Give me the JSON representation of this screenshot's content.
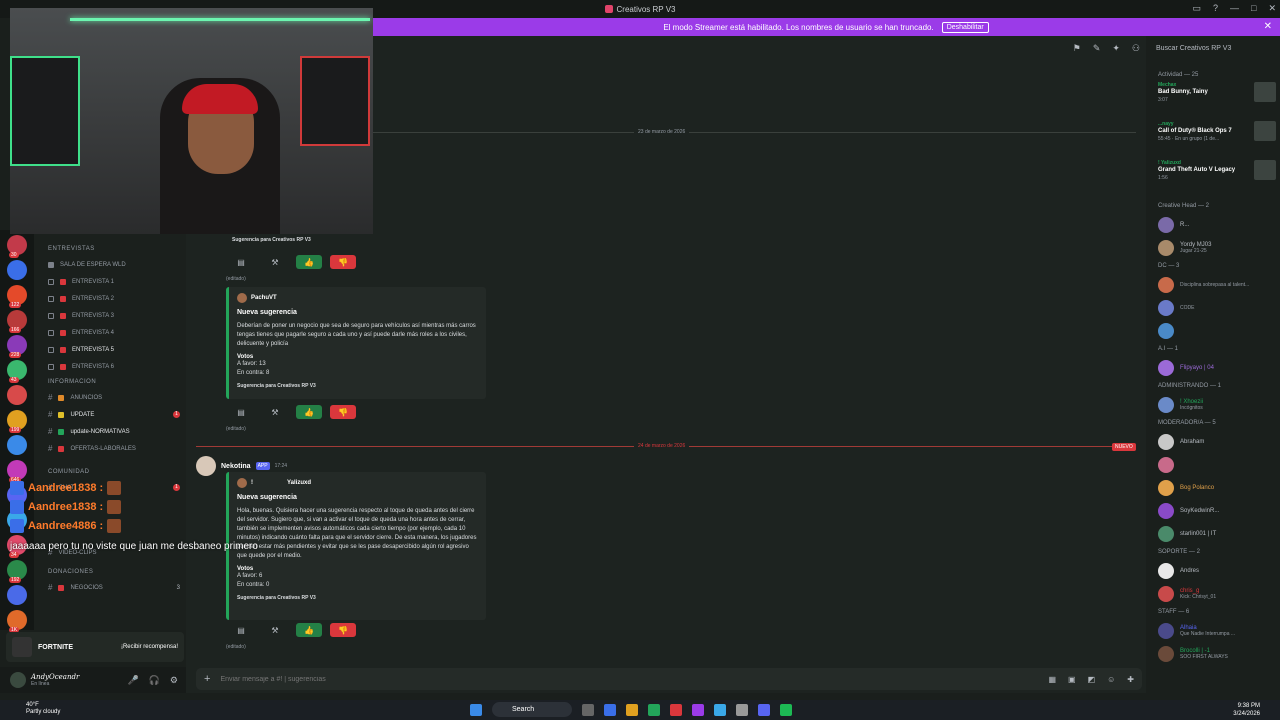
{
  "window": {
    "title": "Creativos RP V3"
  },
  "banner": {
    "text": "El modo Streamer está habilitado. Los nombres de usuario se han truncado.",
    "button": "Deshabilitar"
  },
  "search": {
    "placeholder": "Buscar Creativos RP V3"
  },
  "server_rail": [
    {
      "count": "30",
      "color": "#c23a4a"
    },
    {
      "count": "",
      "color": "#3a6ee8"
    },
    {
      "count": "122",
      "color": "#e44a2a"
    },
    {
      "count": "166",
      "color": "#b83a3a"
    },
    {
      "count": "228",
      "color": "#8a3ab8"
    },
    {
      "count": "43",
      "color": "#3ab86e"
    },
    {
      "count": "",
      "color": "#d84a4a"
    },
    {
      "count": "199",
      "color": "#e0a020"
    },
    {
      "count": "",
      "color": "#3a8ae8"
    },
    {
      "count": "646",
      "color": "#c23ab8"
    },
    {
      "count": "",
      "color": "#5865f2"
    },
    {
      "count": "",
      "color": "#3aa8e8"
    },
    {
      "count": "34",
      "color": "#e04a6a"
    },
    {
      "count": "192",
      "color": "#2a8a4a"
    },
    {
      "count": "",
      "color": "#4a6ae8"
    },
    {
      "count": "1K",
      "color": "#e06a2a"
    },
    {
      "count": "",
      "color": "#2ab86a"
    }
  ],
  "channels": {
    "cat_entrevistas": "ENTREVISTAS",
    "sala_espera": "SALA DE ESPERA WLD",
    "entrevista_1": "ENTREVISTA 1",
    "entrevista_2": "ENTREVISTA 2",
    "entrevista_3": "ENTREVISTA 3",
    "entrevista_4": "ENTREVISTA 4",
    "entrevista_5": "ENTREVISTA 5",
    "entrevista_6": "ENTREVISTA 6",
    "cat_informacion": "INFORMACION",
    "anuncios": "ANUNCIOS",
    "update": "UPDATE",
    "update_badge": "1",
    "update_normativas": "update-NORMATIVAS",
    "ofertas": "OFERTAS-LABORALES",
    "cat_comunidad": "COMUNIDAD",
    "chat": "CHAT",
    "chat_badge": "1",
    "clips": "VIDEO-CLIPS",
    "cat_donaciones": "DONACIONES",
    "negocios": "NEGOCIOS",
    "negocios_count": "3"
  },
  "fortnite": {
    "name": "FORTNITE",
    "cta": "¡Recibir recompensa!"
  },
  "user": {
    "name": "AndyOceandr",
    "status": "En línea"
  },
  "messages": {
    "footer_label": "Sugerencia para Creativos RP V3",
    "edited": "(editado)",
    "date1": "23 de marzo de 2026",
    "date2": "24 de marzo de 2026",
    "new_tag": "NUEVO",
    "embed1": {
      "author": "PachuVT",
      "title": "Nueva sugerencia",
      "desc": "Deberían de poner un negocio que sea de seguro para vehículos así mientras más carros tengas tienes que pagarle seguro a cada uno y así puede darle más roles a los civiles, delicuente y policía",
      "votes_label": "Votos",
      "favor": "A favor: 13",
      "contra": "En contra: 8",
      "footer": "Sugerencia para Creativos RP V3"
    },
    "msg2": {
      "name": "Nekotina",
      "app": "APP",
      "time": "17:24"
    },
    "embed2": {
      "author_prefix": "!",
      "author": "Yalizuxd",
      "title": "Nueva sugerencia",
      "desc": "Hola, buenas. Quisiera hacer una sugerencia respecto al toque de queda antes del cierre del servidor. Sugiero que, si van a activar el toque de queda una hora antes de cerrar, también se implementen avisos automáticos cada cierto tiempo (por ejemplo, cada 10 minutos) indicando cuánto falta para que el servidor cierre. De esta manera, los jugadores pueden estar más pendientes y evitar que se les pase desapercibido algún rol agresivo que quede por el medio.",
      "votes_label": "Votos",
      "favor": "A favor: 6",
      "contra": "En contra: 0",
      "footer": "Sugerencia para Creativos RP V3"
    }
  },
  "composer": {
    "placeholder": "Enviar mensaje a #! | sugerencias"
  },
  "sidebar": {
    "activity_header": "Actividad — 25",
    "activities": [
      {
        "who": "Mechax",
        "game": "Bad Bunny, Tainy",
        "sub": "3:07"
      },
      {
        "who": "...nayy",
        "game": "Call of Duty® Black Ops 7",
        "sub": "55:45 · En un grupo (1 de..."
      },
      {
        "who": "! Yalizuxd",
        "game": "Grand Theft Auto V Legacy",
        "sub": "1:56"
      }
    ],
    "groups": [
      {
        "header": "Creative Head — 2",
        "members": [
          {
            "name": "R...",
            "sub": "",
            "color": "#b5bac1",
            "av": "#7a6aa8"
          },
          {
            "name": "Yordy MJ03",
            "sub": "Jugar 21-25",
            "color": "#b5bac1",
            "av": "#a88a6a"
          }
        ]
      },
      {
        "header": "DC — 3",
        "members": [
          {
            "name": "",
            "sub": "Disciplina sobrepasa al talent...",
            "color": "#da373c",
            "av": "#c86a4a"
          },
          {
            "name": "",
            "sub": "CODE",
            "color": "#da373c",
            "av": "#6a7ac8"
          },
          {
            "name": "",
            "sub": "",
            "color": "#da373c",
            "av": "#4a8ac8"
          }
        ]
      },
      {
        "header": "A.I — 1",
        "members": [
          {
            "name": "Flipyayo | 04",
            "sub": "",
            "color": "#9b6ad8",
            "av": "#9b6ad8"
          }
        ]
      },
      {
        "header": "ADMINISTRANDO — 1",
        "members": [
          {
            "name": "! Xhoezii",
            "sub": "Incógnitos",
            "color": "#23a55a",
            "av": "#6a8ac8"
          }
        ]
      },
      {
        "header": "MODERADOR/A — 5",
        "members": [
          {
            "name": "Abraham",
            "sub": "",
            "color": "#b5bac1",
            "av": "#c8c8c8"
          },
          {
            "name": "",
            "sub": "",
            "color": "#da373c",
            "av": "#c86a8a"
          },
          {
            "name": "Bog Polanco",
            "sub": "",
            "color": "#e0a04a",
            "av": "#e0a04a"
          },
          {
            "name": "SoyKedwinR...",
            "sub": "",
            "color": "#b5bac1",
            "av": "#8a4ac8"
          },
          {
            "name": "starlin001 | IT",
            "sub": "",
            "color": "#b5bac1",
            "av": "#4a8a6a"
          }
        ]
      },
      {
        "header": "SOPORTE — 2",
        "members": [
          {
            "name": "Andres",
            "sub": "",
            "color": "#b5bac1",
            "av": "#e8e8e8"
          },
          {
            "name": "chris_g",
            "sub": "Kick: Chrisyt_01",
            "color": "#da373c",
            "av": "#c84a4a"
          }
        ]
      },
      {
        "header": "STAFF — 6",
        "members": [
          {
            "name": "Alhaia",
            "sub": "Que Nadie Interrumpa ...",
            "color": "#5865f2",
            "av": "#4a4a8a"
          },
          {
            "name": "Brocolli | -1",
            "sub": "SOO FIRST ALWAYS",
            "color": "#23a55a",
            "av": "#6a4a3a"
          }
        ]
      }
    ]
  },
  "stream_chat": {
    "users": [
      "Aandree1838 :",
      "Aandree1838 :",
      "Aandree4886 :"
    ],
    "message": "jaaaaaa pero tu no viste que juan me desbaneo primero"
  },
  "taskbar": {
    "temp": "40°F",
    "weather": "Partly cloudy",
    "search": "Search",
    "time": "9:38 PM",
    "date": "3/24/2026"
  }
}
